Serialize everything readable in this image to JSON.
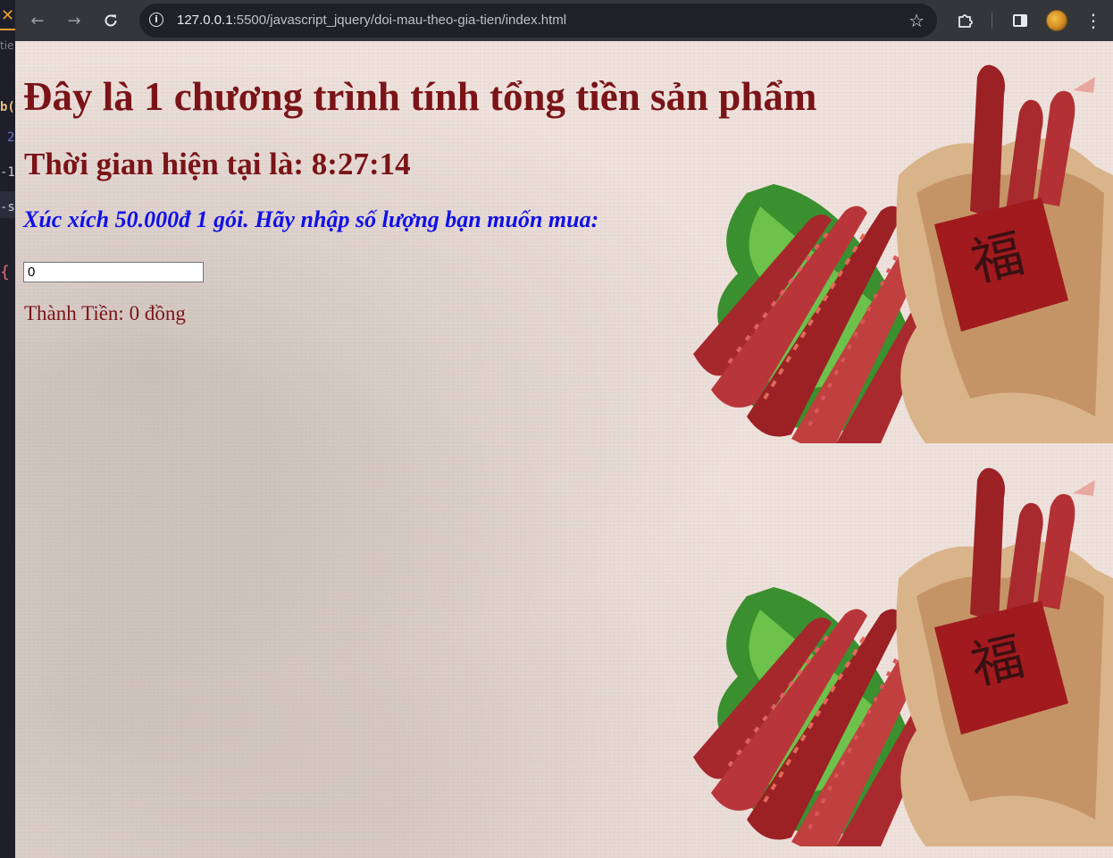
{
  "browser": {
    "url_host": "127.0.0.1",
    "url_path": ":5500/javascript_jquery/doi-mau-theo-gia-tien/index.html"
  },
  "editor_fragments": {
    "tab_text": "tie",
    "f2": "b(",
    "f3": "2",
    "f4": "-1",
    "f5": "-s",
    "f6": "{"
  },
  "page": {
    "title": "Đây là 1 chương trình tính tổng tiền sản phẩm",
    "clock_text": "Thời gian hiện tại là: 8:27:14",
    "prompt": "Xúc xích 50.000đ 1 gói. Hãy nhập số lượng bạn muốn mua:",
    "quantity_value": "0",
    "total_text": "Thành Tiền: 0 đồng"
  },
  "decoration": {
    "tile_count": 2,
    "icon": "fortune-character-fu",
    "glyph": "福"
  },
  "colors": {
    "heading": "#7a1418",
    "prompt": "#1010e8",
    "page_background": "#efe2dd"
  }
}
